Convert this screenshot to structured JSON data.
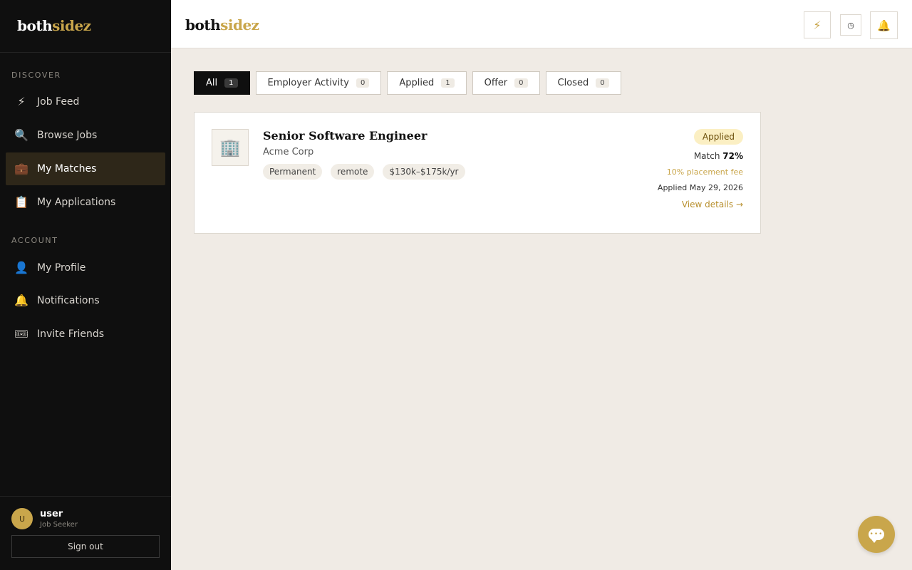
{
  "brand": {
    "part1": "both",
    "part2": "sidez"
  },
  "sidebar": {
    "discover_label": "DISCOVER",
    "account_label": "ACCOUNT",
    "discover_items": [
      {
        "label": "Job Feed",
        "icon": "⚡"
      },
      {
        "label": "Browse Jobs",
        "icon": "🔍"
      },
      {
        "label": "My Matches",
        "icon": "💼"
      },
      {
        "label": "My Applications",
        "icon": "📋"
      }
    ],
    "account_items": [
      {
        "label": "My Profile",
        "icon": "👤"
      },
      {
        "label": "Notifications",
        "icon": "🔔"
      },
      {
        "label": "Invite Friends",
        "icon": "🎟"
      }
    ],
    "active_item": "My Matches"
  },
  "user": {
    "initial": "U",
    "name": "user",
    "role": "Job Seeker",
    "signout_label": "Sign out"
  },
  "header": {
    "bolt_icon": "⚡",
    "clock_icon": "◷",
    "bell_icon": "🔔"
  },
  "tabs": [
    {
      "label": "All",
      "count": "1"
    },
    {
      "label": "Employer Activity",
      "count": "0"
    },
    {
      "label": "Applied",
      "count": "1"
    },
    {
      "label": "Offer",
      "count": "0"
    },
    {
      "label": "Closed",
      "count": "0"
    }
  ],
  "match": {
    "logo_icon": "🏢",
    "title": "Senior Software Engineer",
    "company": "Acme Corp",
    "tags": [
      "Permanent",
      "remote",
      "$130k–$175k/yr"
    ],
    "status": "Applied",
    "match_label": "Match",
    "match_pct": "72%",
    "fee": "10% placement fee",
    "applied_date": "Applied May 29, 2026",
    "view_details": "View details →"
  },
  "colors": {
    "accent": "#c9a64b",
    "sidebar_bg": "#0f0f0f",
    "page_bg": "#f0ebe5",
    "active_nav_bg": "#2e2719"
  }
}
